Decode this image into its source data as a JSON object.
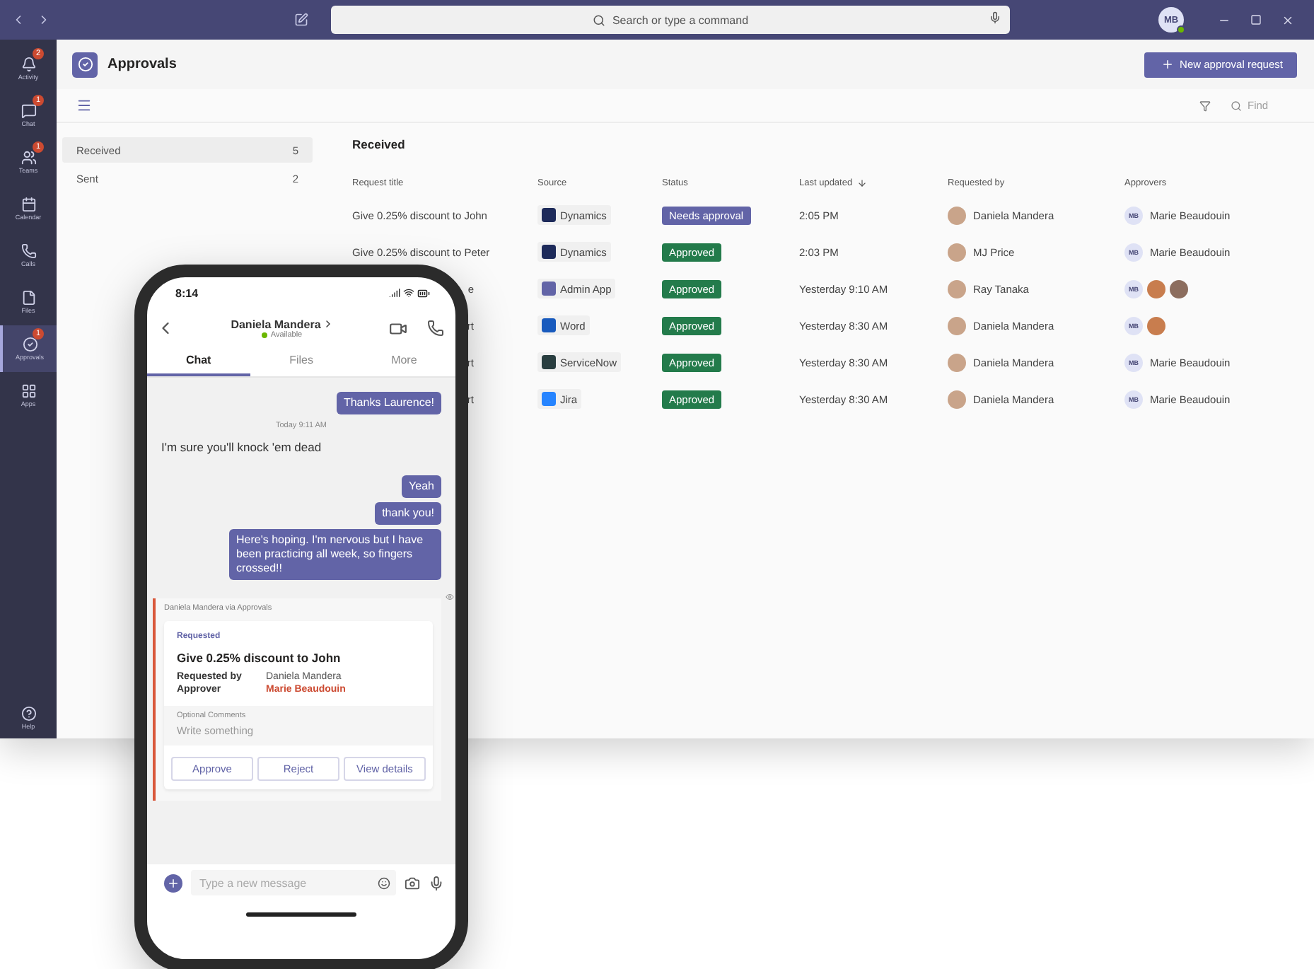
{
  "top_bar": {
    "search_placeholder": "Search or type a command",
    "avatar": "MB"
  },
  "rail": {
    "items": [
      {
        "label": "Activity",
        "badge": "2",
        "selected": false
      },
      {
        "label": "Chat",
        "badge": "1",
        "selected": false
      },
      {
        "label": "Teams",
        "badge": "1",
        "selected": false
      },
      {
        "label": "Calendar",
        "selected": false
      },
      {
        "label": "Calls",
        "selected": false
      },
      {
        "label": "Files",
        "selected": false
      },
      {
        "label": "Approvals",
        "badge": "1",
        "selected": true
      },
      {
        "label": "Apps",
        "selected": false
      }
    ],
    "help": "Help"
  },
  "header": {
    "title": "Approvals",
    "new_button": "New approval request"
  },
  "toolbar": {
    "find_placeholder": "Find"
  },
  "left_list": [
    {
      "label": "Received",
      "count": "5",
      "selected": true
    },
    {
      "label": "Sent",
      "count": "2",
      "selected": false
    }
  ],
  "table": {
    "title": "Received",
    "columns": [
      "Request title",
      "Source",
      "Status",
      "Last updated",
      "Requested by",
      "Approvers"
    ],
    "rows": [
      {
        "title": "Give 0.25% discount to John",
        "cut_off": false,
        "source": {
          "name": "Dynamics",
          "color": "#1d2a5a"
        },
        "status": {
          "label": "Needs approval",
          "color": "#6264a7"
        },
        "updated": "2:05 PM",
        "requested_by": "Daniela Mandera",
        "approvers": [
          {
            "kind": "initials",
            "initials": "MB"
          }
        ],
        "approver_name": "Marie Beaudouin"
      },
      {
        "title": "Give 0.25% discount to Peter",
        "cut_off": false,
        "source": {
          "name": "Dynamics",
          "color": "#1d2a5a"
        },
        "status": {
          "label": "Approved",
          "color": "#237b4b"
        },
        "updated": "2:03 PM",
        "requested_by": "MJ Price",
        "approvers": [
          {
            "kind": "initials",
            "initials": "MB"
          }
        ],
        "approver_name": "Marie Beaudouin"
      },
      {
        "title": "e",
        "cut_off": true,
        "source": {
          "name": "Admin App",
          "color": "#6264a7"
        },
        "status": {
          "label": "Approved",
          "color": "#237b4b"
        },
        "updated": "Yesterday 9:10 AM",
        "requested_by": "Ray Tanaka",
        "approvers": [
          {
            "kind": "initials",
            "initials": "MB"
          },
          {
            "kind": "photo"
          },
          {
            "kind": "photo"
          }
        ]
      },
      {
        "title": "rt",
        "cut_off": true,
        "source": {
          "name": "Word",
          "color": "#185abd"
        },
        "status": {
          "label": "Approved",
          "color": "#237b4b"
        },
        "updated": "Yesterday 8:30 AM",
        "requested_by": "Daniela Mandera",
        "approvers": [
          {
            "kind": "initials",
            "initials": "MB"
          },
          {
            "kind": "photo"
          }
        ]
      },
      {
        "title": "rt",
        "cut_off": true,
        "source": {
          "name": "ServiceNow",
          "color": "#293e40"
        },
        "status": {
          "label": "Approved",
          "color": "#237b4b"
        },
        "updated": "Yesterday 8:30 AM",
        "requested_by": "Daniela Mandera",
        "approvers": [
          {
            "kind": "initials",
            "initials": "MB"
          }
        ],
        "approver_name": "Marie Beaudouin"
      },
      {
        "title": "rt",
        "cut_off": true,
        "source": {
          "name": "Jira",
          "color": "#2684ff"
        },
        "status": {
          "label": "Approved",
          "color": "#237b4b"
        },
        "updated": "Yesterday 8:30 AM",
        "requested_by": "Daniela Mandera",
        "approvers": [
          {
            "kind": "initials",
            "initials": "MB"
          }
        ],
        "approver_name": "Marie Beaudouin"
      }
    ]
  },
  "phone": {
    "time": "8:14",
    "contact": "Daniela Mandera",
    "presence": "Available",
    "tabs": [
      {
        "label": "Chat",
        "selected": true
      },
      {
        "label": "Files",
        "selected": false
      },
      {
        "label": "More",
        "selected": false
      }
    ],
    "messages": [
      {
        "kind": "sent",
        "text": "Thanks Laurence!"
      },
      {
        "kind": "timestamp",
        "text": "Today 9:11 AM"
      },
      {
        "kind": "received",
        "text": "I'm sure you'll knock 'em dead"
      },
      {
        "kind": "sent",
        "text": "Yeah"
      },
      {
        "kind": "sent",
        "text": "thank you!"
      },
      {
        "kind": "sent",
        "text": "Here's hoping. I'm nervous but I have been practicing all week, so fingers crossed!!"
      }
    ],
    "card": {
      "via": "Daniela Mandera via Approvals",
      "state": "Requested",
      "title": "Give 0.25% discount to John",
      "fields": [
        {
          "label": "Requested by",
          "value": "Daniela Mandera",
          "highlight": false
        },
        {
          "label": "Approver",
          "value": "Marie Beaudouin",
          "highlight": true
        }
      ],
      "comments_label": "Optional Comments",
      "comments_placeholder": "Write something",
      "buttons": [
        "Approve",
        "Reject",
        "View details"
      ]
    },
    "compose_placeholder": "Type a new message"
  }
}
